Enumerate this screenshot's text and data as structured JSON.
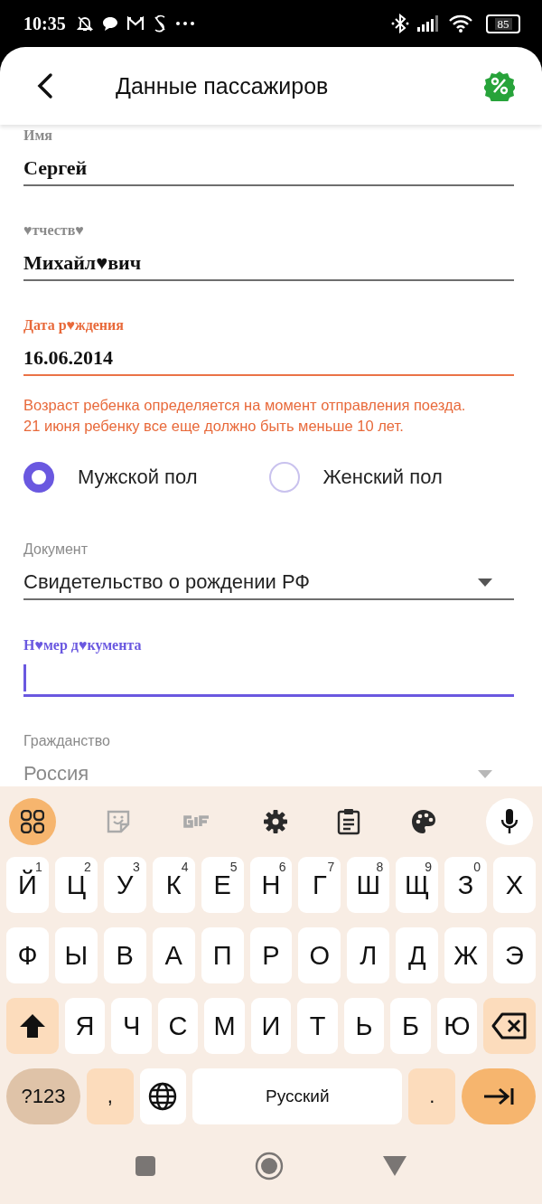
{
  "status_bar": {
    "time": "10:35",
    "battery": "85"
  },
  "header": {
    "title": "Данные пассажиров"
  },
  "fields_top": [
    {
      "kind": "text",
      "label": "Имя",
      "value": "Сергей",
      "error": false,
      "focused": false,
      "disabled": false
    },
    {
      "kind": "text",
      "label": "♥тчеств♥",
      "value": "Михайл♥вич",
      "error": false,
      "focused": false,
      "disabled": false
    },
    {
      "kind": "text",
      "label": "Дата р♥ждения",
      "value": "16.06.2014",
      "error": true,
      "focused": false,
      "disabled": false,
      "message": [
        "Возраст ребенка определяется на момент отправления поезда.",
        "21 июня ребенку все еще должно быть меньше 10 лет."
      ]
    }
  ],
  "gender": [
    {
      "label": "Мужской пол",
      "selected": true
    },
    {
      "label": "Женский пол",
      "selected": false
    }
  ],
  "fields_bottom": [
    {
      "kind": "select",
      "label": "Документ",
      "value": "Свидетельство о рождении РФ",
      "error": false,
      "focused": false,
      "disabled": false
    },
    {
      "kind": "text",
      "label": "Н♥мер д♥кумента",
      "error": false,
      "focused": true,
      "disabled": false
    },
    {
      "kind": "select",
      "label": "Гражданство",
      "value": "Россия",
      "error": false,
      "focused": false,
      "disabled": true
    }
  ],
  "keyboard": {
    "rows": [
      {
        "keys": [
          {
            "label": "Й",
            "hint": "1"
          },
          {
            "label": "Ц",
            "hint": "2"
          },
          {
            "label": "У",
            "hint": "3"
          },
          {
            "label": "К",
            "hint": "4"
          },
          {
            "label": "Е",
            "hint": "5"
          },
          {
            "label": "Н",
            "hint": "6"
          },
          {
            "label": "Г",
            "hint": "7"
          },
          {
            "label": "Ш",
            "hint": "8"
          },
          {
            "label": "Щ",
            "hint": "9"
          },
          {
            "label": "З",
            "hint": "0"
          },
          {
            "label": "Х"
          }
        ]
      },
      {
        "keys": [
          {
            "label": "Ф"
          },
          {
            "label": "Ы"
          },
          {
            "label": "В"
          },
          {
            "label": "А"
          },
          {
            "label": "П"
          },
          {
            "label": "Р"
          },
          {
            "label": "О"
          },
          {
            "label": "Л"
          },
          {
            "label": "Д"
          },
          {
            "label": "Ж"
          },
          {
            "label": "Э"
          }
        ]
      },
      {
        "keys": [
          {
            "kind": "shift"
          },
          {
            "kind": "letter",
            "label": "Я"
          },
          {
            "kind": "letter",
            "label": "Ч"
          },
          {
            "kind": "letter",
            "label": "С"
          },
          {
            "kind": "letter",
            "label": "М"
          },
          {
            "kind": "letter",
            "label": "И"
          },
          {
            "kind": "letter",
            "label": "Т"
          },
          {
            "kind": "letter",
            "label": "Ь"
          },
          {
            "kind": "letter",
            "label": "Б"
          },
          {
            "kind": "letter",
            "label": "Ю"
          },
          {
            "kind": "backspace"
          }
        ]
      },
      {
        "keys": [
          {
            "kind": "mode",
            "label": "?123"
          },
          {
            "kind": "punct",
            "label": ","
          },
          {
            "kind": "globe"
          },
          {
            "kind": "space",
            "label": "Русский"
          },
          {
            "kind": "punct",
            "label": "."
          },
          {
            "kind": "enter"
          }
        ]
      }
    ]
  }
}
